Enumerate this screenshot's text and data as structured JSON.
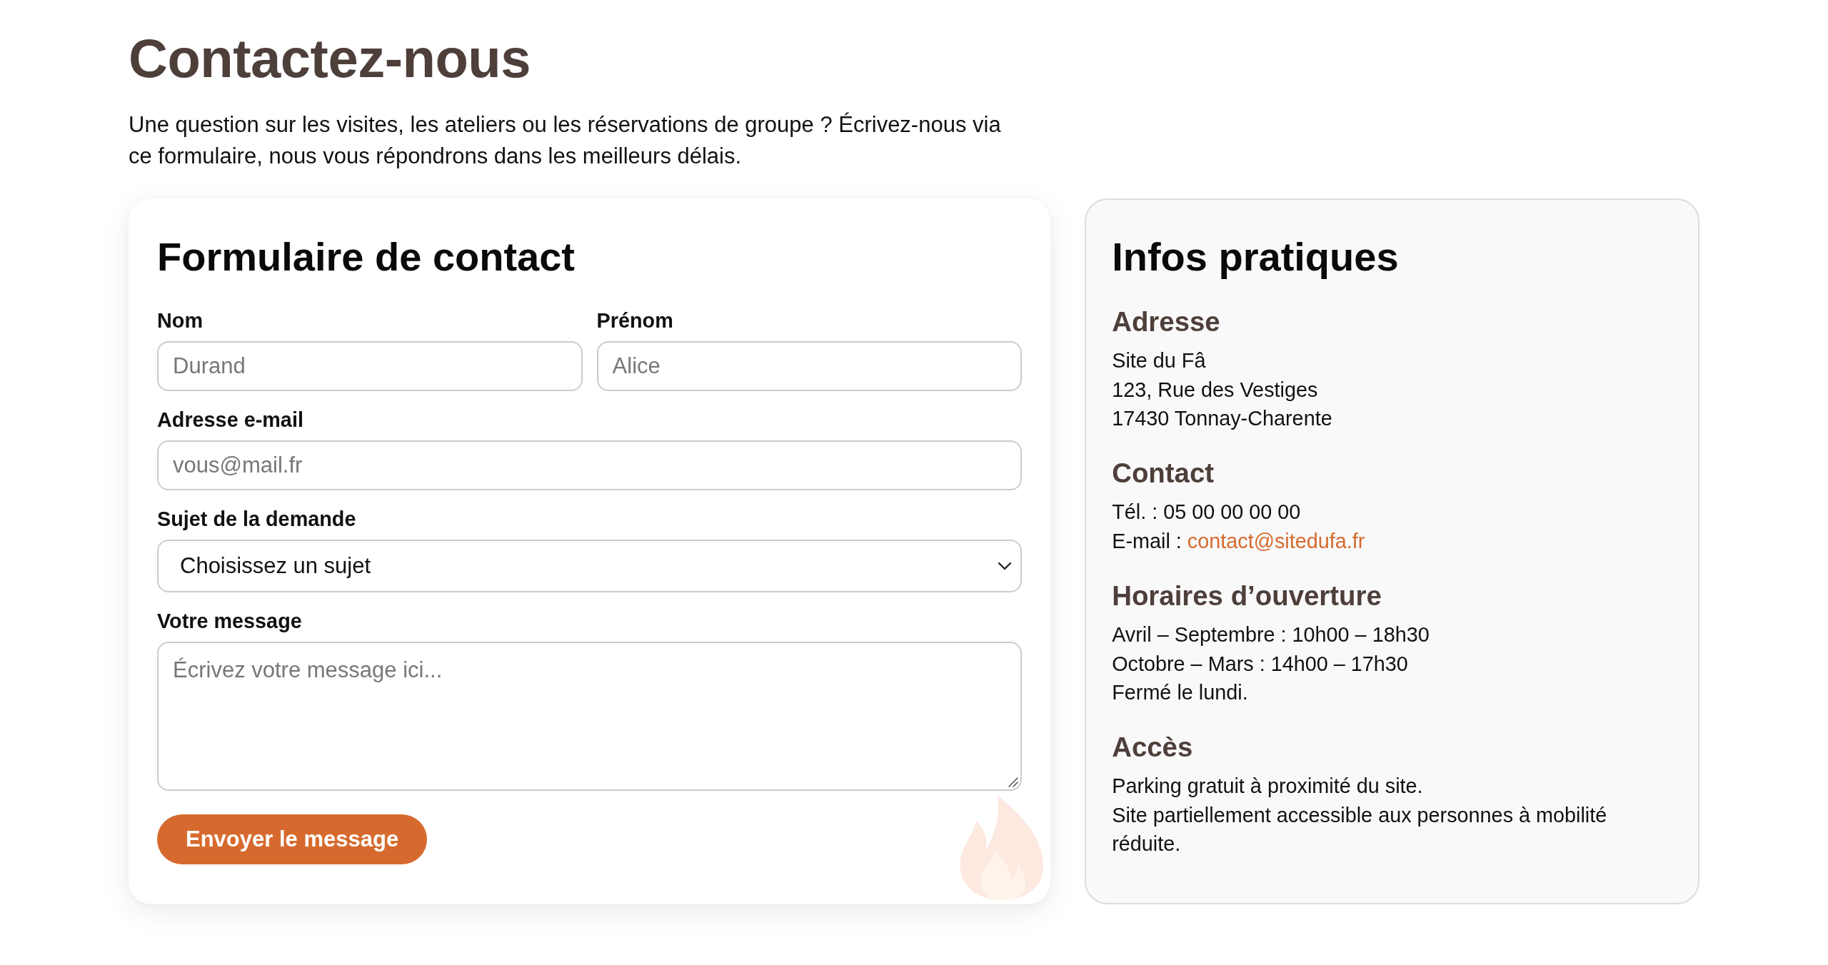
{
  "page": {
    "title": "Contactez-nous",
    "intro": "Une question sur les visites, les ateliers ou les réservations de groupe ? Écrivez-nous via ce formulaire, nous vous répondrons dans les meilleurs délais."
  },
  "contact_form": {
    "title": "Formulaire de contact",
    "rows": [
      {
        "fields": [
          {
            "kind": "text",
            "label": "Nom",
            "placeholder": "Durand"
          },
          {
            "kind": "text",
            "label": "Prénom",
            "placeholder": "Alice"
          }
        ]
      },
      {
        "fields": [
          {
            "kind": "email",
            "label": "Adresse e-mail",
            "placeholder": "vous@mail.fr"
          }
        ]
      },
      {
        "fields": [
          {
            "kind": "select",
            "label": "Sujet de la demande",
            "value": "Choisissez un sujet"
          }
        ]
      },
      {
        "fields": [
          {
            "kind": "textarea",
            "label": "Votre message",
            "placeholder": "Écrivez votre message ici..."
          }
        ]
      }
    ],
    "submit_button": "Envoyer le message"
  },
  "info_panel": {
    "title": "Infos pratiques",
    "sections": [
      {
        "heading": "Adresse",
        "lines": [
          {
            "text": "Site du Fâ"
          },
          {
            "text": "123, Rue des Vestiges"
          },
          {
            "text": "17430 Tonnay-Charente"
          }
        ]
      },
      {
        "heading": "Contact",
        "lines": [
          {
            "text": "Tél. : 05 00 00 00 00"
          },
          {
            "text": "E-mail :",
            "link": "contact@sitedufa.fr"
          }
        ]
      },
      {
        "heading": "Horaires d’ouverture",
        "lines": [
          {
            "text": "Avril – Septembre : 10h00 – 18h30"
          },
          {
            "text": "Octobre – Mars : 14h00 – 17h30"
          },
          {
            "text": "Fermé le lundi."
          }
        ]
      },
      {
        "heading": "Accès",
        "lines": [
          {
            "text": "Parking gratuit à proximité du site."
          },
          {
            "text": "Site partiellement accessible aux personnes à mobilité réduite."
          }
        ]
      }
    ]
  }
}
